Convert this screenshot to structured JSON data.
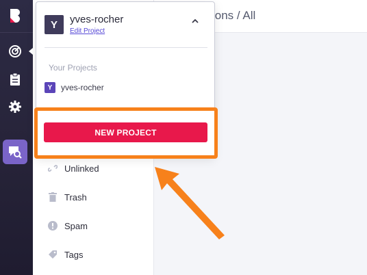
{
  "header": {
    "title": "ions / All"
  },
  "project_menu": {
    "current_project": {
      "initial": "Y",
      "name": "yves-rocher",
      "edit_label": "Edit Project"
    },
    "section_label": "Your Projects",
    "projects": [
      {
        "initial": "Y",
        "name": "yves-rocher"
      }
    ],
    "new_project_label": "NEW PROJECT"
  },
  "sidebar": {
    "items": [
      {
        "label": "Unlinked",
        "icon": "unlink-icon"
      },
      {
        "label": "Trash",
        "icon": "trash-icon"
      },
      {
        "label": "Spam",
        "icon": "alert-icon"
      },
      {
        "label": "Tags",
        "icon": "tag-icon"
      }
    ]
  },
  "rail": {
    "icons": [
      "logo",
      "radar-icon",
      "clipboard-icon",
      "gear-icon",
      "chat-search-icon"
    ]
  },
  "colors": {
    "accent": "#e8184b",
    "highlight": "#f7811b",
    "rail_bg": "#2d2b45",
    "brand_purple": "#5b45b8"
  }
}
